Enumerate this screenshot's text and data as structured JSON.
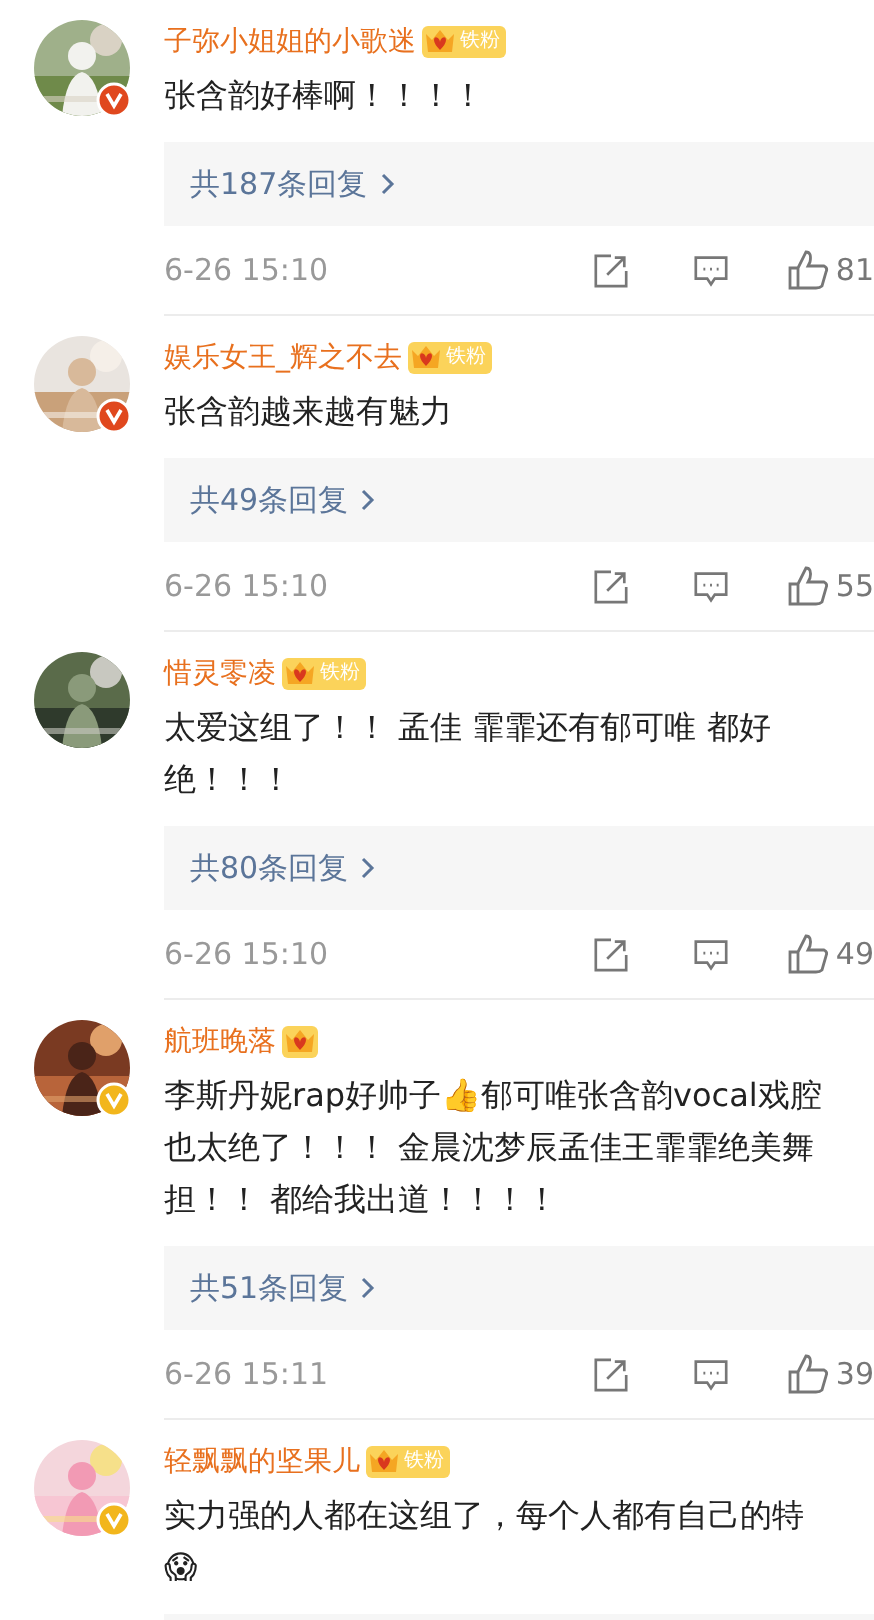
{
  "comments": [
    {
      "verified": {
        "color": "#e0481e"
      },
      "name": "子弥小姐姐的小歌迷",
      "badge_label": "铁粉",
      "text": "张含韵好棒啊！！！！",
      "replies": "共187条回复",
      "time": "6-26 15:10",
      "likes": "81"
    },
    {
      "verified": {
        "color": "#e0481e"
      },
      "name": "娱乐女王_辉之不去",
      "badge_label": "铁粉",
      "text": "张含韵越来越有魅力",
      "replies": "共49条回复",
      "time": "6-26 15:10",
      "likes": "55"
    },
    {
      "name": "惜灵零凌",
      "badge_label": "铁粉",
      "text": "太爱这组了！！ 孟佳 霏霏还有郁可唯 都好绝！！！",
      "replies": "共80条回复",
      "time": "6-26 15:10",
      "likes": "49"
    },
    {
      "verified": {
        "color": "#f2b61c"
      },
      "name": "航班晚落",
      "text": "李斯丹妮rap好帅子👍郁可唯张含韵vocal戏腔也太绝了！！！ 金晨沈梦辰孟佳王霏霏绝美舞担！！ 都给我出道！！！！",
      "replies": "共51条回复",
      "time": "6-26 15:11",
      "likes": "39"
    },
    {
      "verified": {
        "color": "#f2b61c"
      },
      "name": "轻飘飘的坚果儿",
      "badge_label": "铁粉",
      "text": "实力强的人都在这组了，每个人都有自己的特\n😱"
    }
  ]
}
